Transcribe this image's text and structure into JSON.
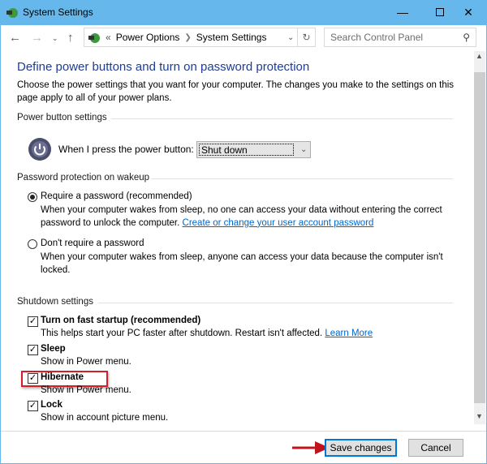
{
  "window": {
    "title": "System Settings",
    "minimize_icon": "minimize-icon",
    "maximize_icon": "maximize-icon",
    "close_icon": "close-icon"
  },
  "address": {
    "prefix": "«",
    "crumbs": [
      "Power Options",
      "System Settings"
    ],
    "search_placeholder": "Search Control Panel"
  },
  "page": {
    "heading": "Define power buttons and turn on password protection",
    "description": "Choose the power settings that you want for your computer. The changes you make to the settings on this page apply to all of your power plans.",
    "power_group": {
      "title": "Power button settings",
      "label": "When I press the power button:",
      "selected": "Shut down"
    },
    "password_group": {
      "title": "Password protection on wakeup",
      "options": [
        {
          "label": "Require a password (recommended)",
          "selected": true,
          "desc": "When your computer wakes from sleep, no one can access your data without entering the correct password to unlock the computer.",
          "link": "Create or change your user account password"
        },
        {
          "label": "Don't require a password",
          "selected": false,
          "desc": "When your computer wakes from sleep, anyone can access your data because the computer isn't locked."
        }
      ]
    },
    "shutdown_group": {
      "title": "Shutdown settings",
      "items": [
        {
          "label": "Turn on fast startup (recommended)",
          "checked": true,
          "desc": "This helps start your PC faster after shutdown. Restart isn't affected.",
          "link": "Learn More"
        },
        {
          "label": "Sleep",
          "checked": true,
          "desc": "Show in Power menu."
        },
        {
          "label": "Hibernate",
          "checked": true,
          "desc": "Show in Power menu.",
          "highlighted": true
        },
        {
          "label": "Lock",
          "checked": true,
          "desc": "Show in account picture menu."
        }
      ]
    }
  },
  "footer": {
    "save": "Save changes",
    "cancel": "Cancel"
  },
  "colors": {
    "titlebar": "#66b8ec",
    "heading": "#1e3c96",
    "link": "#0066cc",
    "highlight": "#d0202a"
  }
}
